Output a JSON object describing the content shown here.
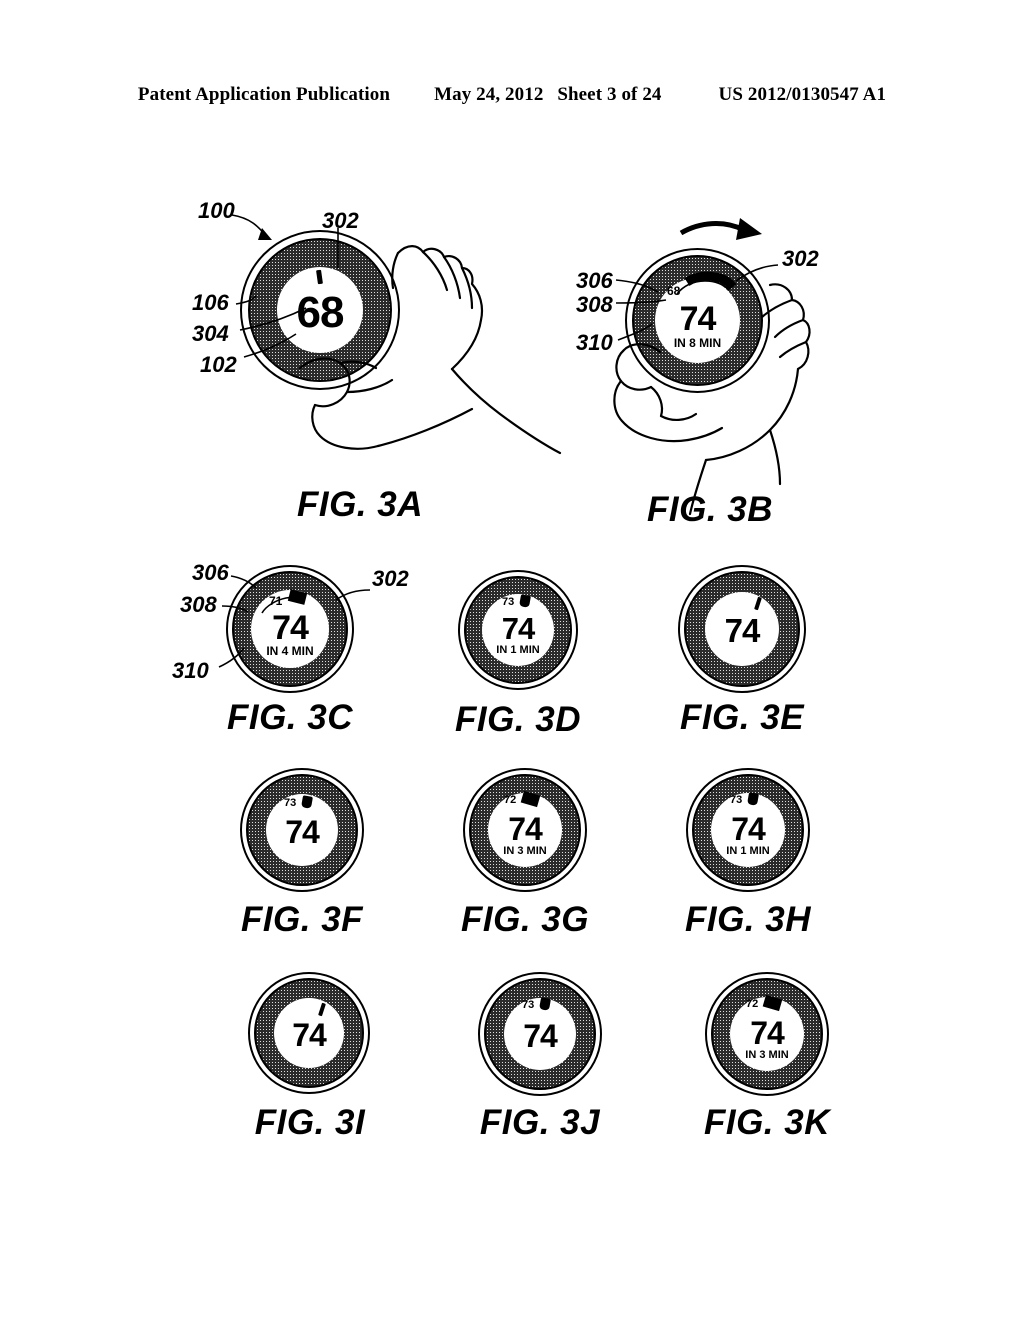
{
  "header": {
    "publication": "Patent Application Publication",
    "date": "May 24, 2012",
    "sheet": "Sheet 3 of 24",
    "docnum": "US 2012/0130547 A1"
  },
  "figures": [
    {
      "id": "3A",
      "label": "FIG. 3A",
      "temp": "68",
      "subtext": "",
      "marker_value": "",
      "marker_style": "thin-tick",
      "has_hand": true,
      "has_rotation_arrow": false,
      "refs": [
        "100",
        "302",
        "106",
        "304",
        "102"
      ]
    },
    {
      "id": "3B",
      "label": "FIG. 3B",
      "temp": "74",
      "subtext": "IN 8 MIN",
      "marker_value": "68",
      "marker_style": "arc-band",
      "has_hand": true,
      "has_rotation_arrow": true,
      "refs": [
        "306",
        "308",
        "310",
        "302"
      ]
    },
    {
      "id": "3C",
      "label": "FIG. 3C",
      "temp": "74",
      "subtext": "IN 4 MIN",
      "marker_value": "71",
      "marker_style": "wedge-wide",
      "has_hand": false,
      "has_rotation_arrow": false,
      "refs": [
        "306",
        "302",
        "308",
        "310"
      ]
    },
    {
      "id": "3D",
      "label": "FIG. 3D",
      "temp": "74",
      "subtext": "IN 1 MIN",
      "marker_value": "73",
      "marker_style": "wedge-small",
      "has_hand": false,
      "has_rotation_arrow": false,
      "refs": []
    },
    {
      "id": "3E",
      "label": "FIG. 3E",
      "temp": "74",
      "subtext": "",
      "marker_value": "",
      "marker_style": "thin-tick",
      "has_hand": false,
      "has_rotation_arrow": false,
      "refs": []
    },
    {
      "id": "3F",
      "label": "FIG. 3F",
      "temp": "74",
      "subtext": "",
      "marker_value": "73",
      "marker_style": "wedge-small",
      "has_hand": false,
      "has_rotation_arrow": false,
      "refs": []
    },
    {
      "id": "3G",
      "label": "FIG. 3G",
      "temp": "74",
      "subtext": "IN 3 MIN",
      "marker_value": "72",
      "marker_style": "wedge-wide",
      "has_hand": false,
      "has_rotation_arrow": false,
      "refs": []
    },
    {
      "id": "3H",
      "label": "FIG. 3H",
      "temp": "74",
      "subtext": "IN 1 MIN",
      "marker_value": "73",
      "marker_style": "wedge-small",
      "has_hand": false,
      "has_rotation_arrow": false,
      "refs": []
    },
    {
      "id": "3I",
      "label": "FIG. 3I",
      "temp": "74",
      "subtext": "",
      "marker_value": "",
      "marker_style": "thin-tick",
      "has_hand": false,
      "has_rotation_arrow": false,
      "refs": []
    },
    {
      "id": "3J",
      "label": "FIG. 3J",
      "temp": "74",
      "subtext": "",
      "marker_value": "73",
      "marker_style": "wedge-small",
      "has_hand": false,
      "has_rotation_arrow": false,
      "refs": []
    },
    {
      "id": "3K",
      "label": "FIG. 3K",
      "temp": "74",
      "subtext": "IN 3 MIN",
      "marker_value": "72",
      "marker_style": "wedge-wide",
      "has_hand": false,
      "has_rotation_arrow": false,
      "refs": []
    }
  ],
  "ref_labels": {
    "a_100": "100",
    "a_302": "302",
    "a_106": "106",
    "a_304": "304",
    "a_102": "102",
    "b_306": "306",
    "b_308": "308",
    "b_310": "310",
    "b_302": "302",
    "c_306": "306",
    "c_302": "302",
    "c_308": "308",
    "c_310": "310"
  },
  "colors": {
    "ink": "#000000",
    "ring_fill": "#2b2b2b",
    "page": "#ffffff"
  }
}
